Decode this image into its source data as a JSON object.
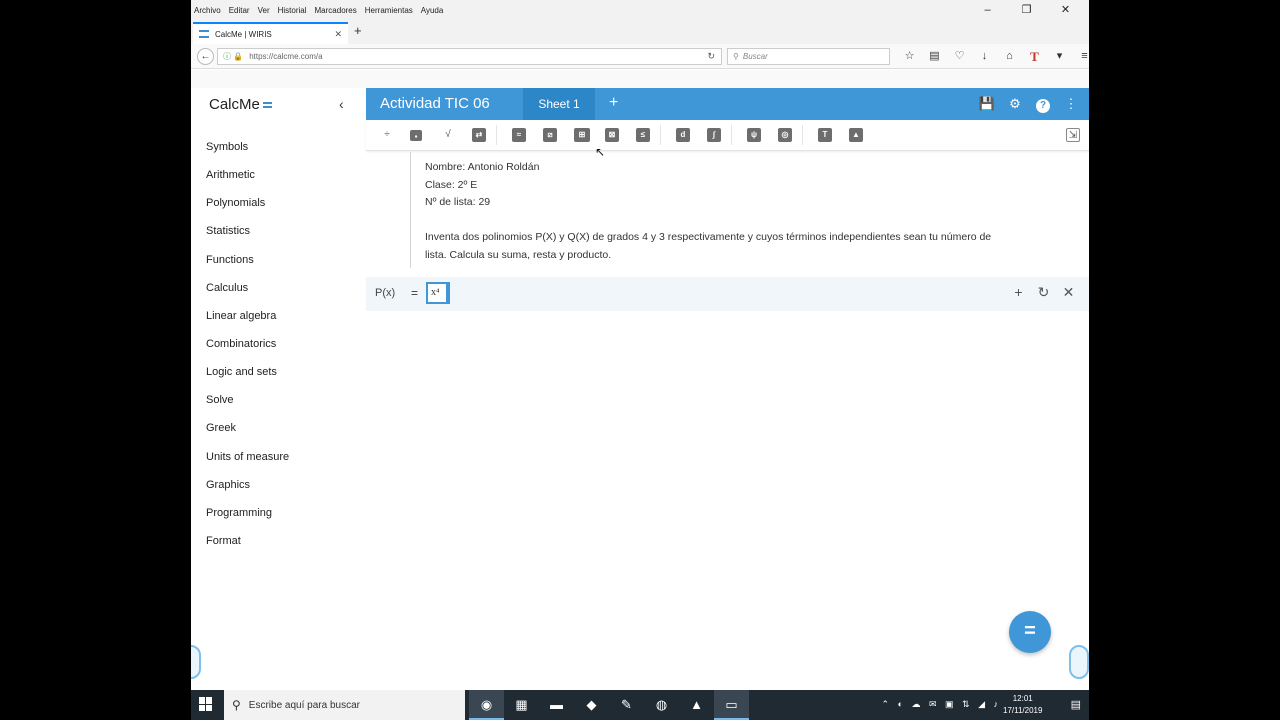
{
  "browser": {
    "menu": [
      "Archivo",
      "Editar",
      "Ver",
      "Historial",
      "Marcadores",
      "Herramientas",
      "Ayuda"
    ],
    "tab_title": "CalcMe | WIRIS",
    "url": "https://calcme.com/a",
    "search_placeholder": "Buscar"
  },
  "app": {
    "brand": "CalcMe",
    "title": "Actividad TIC 06",
    "sheet_tab": "Sheet 1",
    "accent": "#3f97d8"
  },
  "sidebar": {
    "items": [
      "Symbols",
      "Arithmetic",
      "Polynomials",
      "Statistics",
      "Functions",
      "Calculus",
      "Linear algebra",
      "Combinatorics",
      "Logic and sets",
      "Solve",
      "Greek",
      "Units of measure",
      "Graphics",
      "Programming",
      "Format"
    ]
  },
  "document": {
    "line1": "Nombre: Antonio Roldán",
    "line2": "Clase: 2º E",
    "line3": "Nº de lista: 29",
    "para1": "Inventa dos polinomios P(X) y Q(X) de grados 4 y 3 respectivamente y cuyos términos independientes sean tu número de",
    "para2": "lista. Calcula su suma, resta y producto."
  },
  "calc": {
    "label": "P(x)",
    "equals": "=",
    "input": "x⁴"
  },
  "fab_label": "=",
  "taskbar": {
    "search_placeholder": "Escribe aquí para buscar",
    "time": "12:01",
    "date": "17/11/2019"
  }
}
